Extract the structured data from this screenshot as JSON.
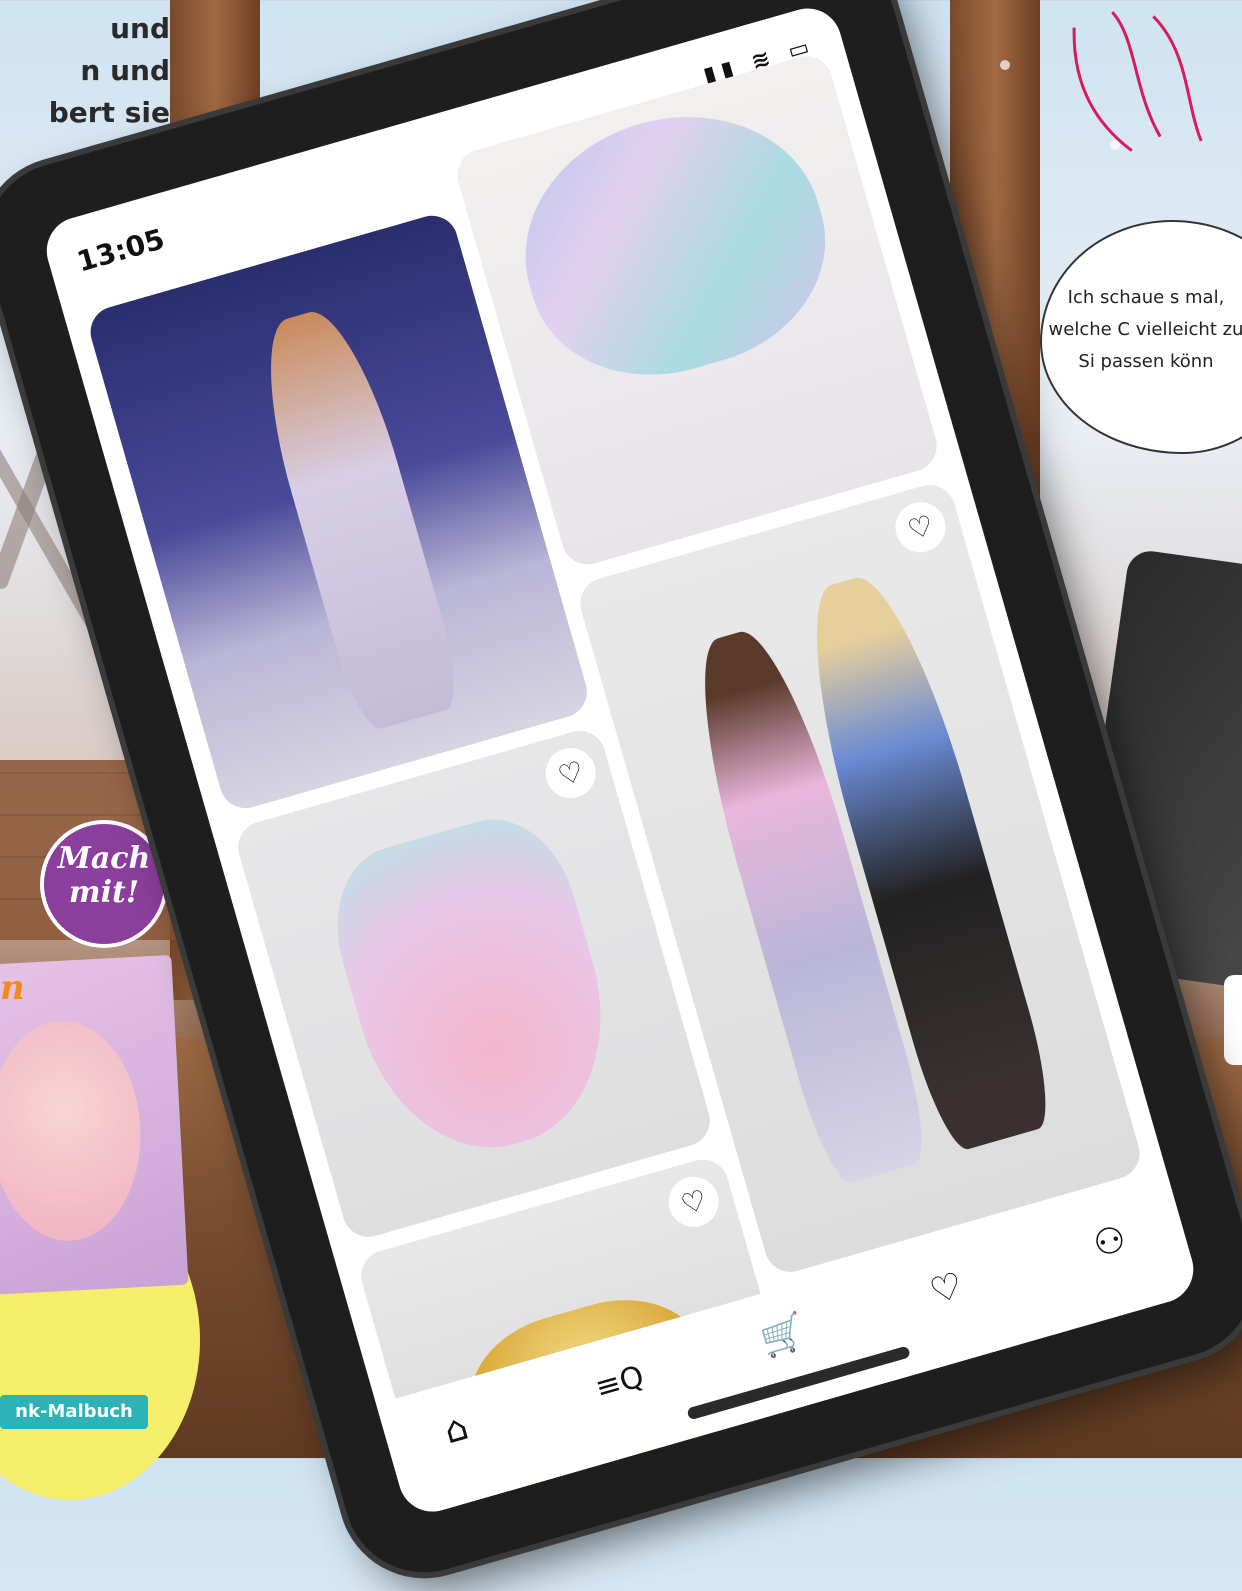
{
  "intro": {
    "text": "und\nn und\nbert sie\nn ..."
  },
  "speech_cloud": {
    "text": "Ich schaue s mal, welche C vielleicht zu Si passen könn"
  },
  "badge": {
    "line1": "Mach",
    "line2": "mit!"
  },
  "book": {
    "label": "nk-Malbuch"
  },
  "tablet": {
    "clock": "13:05",
    "status_icons": "▮▮ ≋ ▭",
    "cards": [
      {
        "id": "evening-gown",
        "liked": false
      },
      {
        "id": "iridescent-dress",
        "liked": false
      },
      {
        "id": "ruffle-rose-dress",
        "liked": false,
        "like_icon": "heart-outline"
      },
      {
        "id": "two-friends-outfit",
        "liked": false,
        "like_icon": "heart-outline"
      },
      {
        "id": "gold-ruffle-top",
        "liked": false,
        "like_icon": "heart-outline"
      }
    ],
    "nav": {
      "home_icon": "⌂",
      "search_icon": "≡Q",
      "cart_icon": "🛒",
      "favorites_icon": "♡",
      "profile_icon": "⚇"
    },
    "heart_glyph": "♡"
  }
}
